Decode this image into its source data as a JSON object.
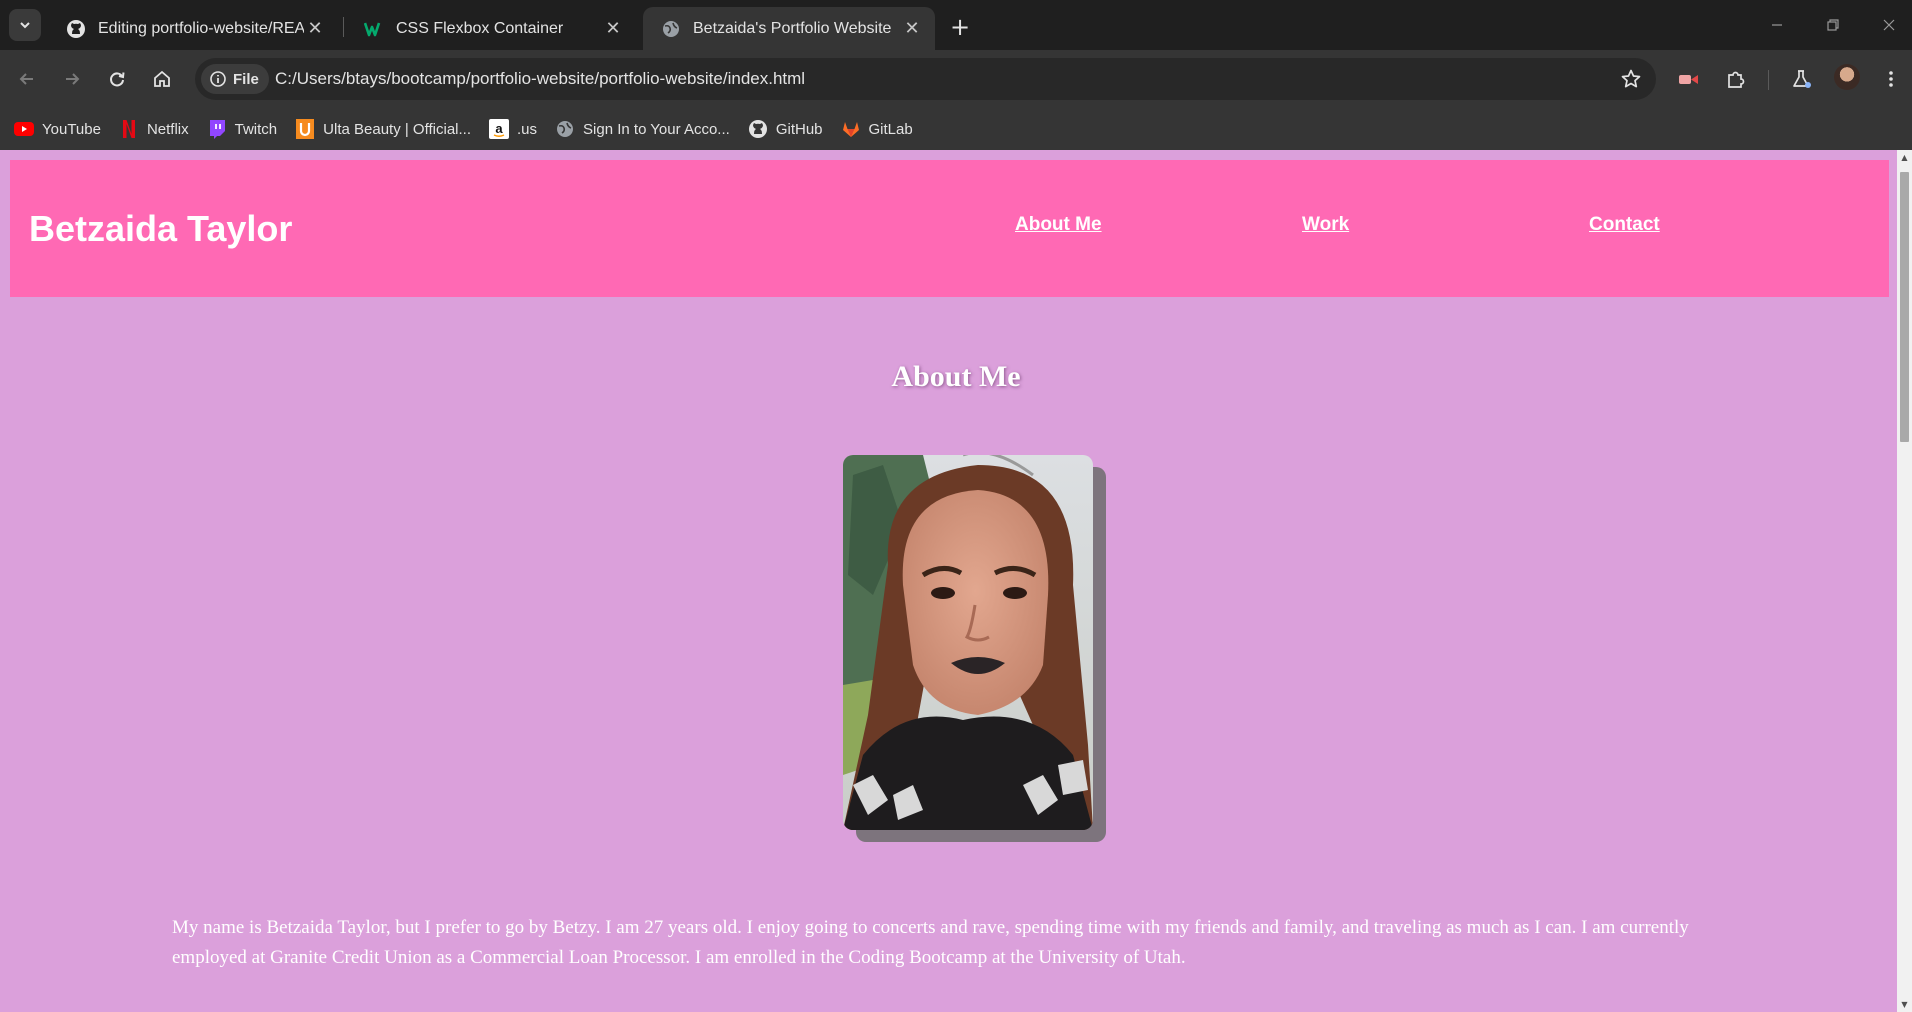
{
  "browser": {
    "tabs": [
      {
        "title": "Editing portfolio-website/README",
        "favicon": "github-icon",
        "active": false
      },
      {
        "title": "CSS Flexbox Container",
        "favicon": "w3schools-icon",
        "active": false
      },
      {
        "title": "Betzaida's Portfolio Website",
        "favicon": "globe-icon",
        "active": true
      }
    ],
    "address": {
      "chip_label": "File",
      "url": "C:/Users/btays/bootcamp/portfolio-website/portfolio-website/index.html"
    },
    "bookmarks": [
      {
        "label": "YouTube",
        "icon": "youtube-icon"
      },
      {
        "label": "Netflix",
        "icon": "netflix-icon"
      },
      {
        "label": "Twitch",
        "icon": "twitch-icon"
      },
      {
        "label": "Ulta Beauty | Official...",
        "icon": "ulta-icon"
      },
      {
        "label": ".us",
        "icon": "amazon-icon"
      },
      {
        "label": "Sign In to Your Acco...",
        "icon": "globe-icon"
      },
      {
        "label": "GitHub",
        "icon": "github-icon"
      },
      {
        "label": "GitLab",
        "icon": "gitlab-icon"
      }
    ],
    "colors": {
      "chrome_dark": "#1f1f1f",
      "chrome": "#353535",
      "omnibox": "#282828"
    }
  },
  "page": {
    "site_name": "Betzaida Taylor",
    "nav": [
      {
        "label": "About Me"
      },
      {
        "label": "Work"
      },
      {
        "label": "Contact"
      }
    ],
    "about": {
      "heading": "About Me",
      "bio": "My name is Betzaida Taylor, but I prefer to go by Betzy. I am 27 years old. I enjoy going to concerts and rave, spending time with my friends and family, and traveling as much as I can. I am currently employed at Granite Credit Union as a Commercial Loan Processor. I am enrolled in the Coding Bootcamp at the University of Utah."
    },
    "colors": {
      "background": "#dba0db",
      "header": "#ff69b4",
      "text": "#ffffff"
    }
  }
}
